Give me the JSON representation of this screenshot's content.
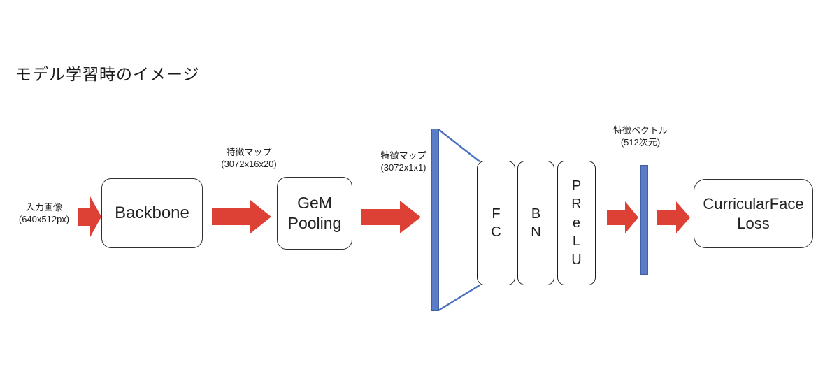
{
  "title": "モデル学習時のイメージ",
  "diagram": {
    "type": "pipeline-flow",
    "blocks": [
      {
        "id": "backbone",
        "label": "Backbone"
      },
      {
        "id": "gem_pooling",
        "label_line1": "GeM",
        "label_line2": "Pooling"
      },
      {
        "id": "fc",
        "letters": [
          "F",
          "C"
        ]
      },
      {
        "id": "bn",
        "letters": [
          "B",
          "N"
        ]
      },
      {
        "id": "prelu",
        "letters": [
          "P",
          "R",
          "e",
          "L",
          "U"
        ]
      },
      {
        "id": "curricularface_loss",
        "label_line1": "CurricularFace",
        "label_line2": "Loss"
      }
    ],
    "captions": {
      "input_image": {
        "line1": "入力画像",
        "line2": "(640x512px)"
      },
      "feature_map_1": {
        "line1": "特徴マップ",
        "line2": "(3072x16x20)"
      },
      "feature_map_2": {
        "line1": "特徴マップ",
        "line2": "(3072x1x1)"
      },
      "feature_vector": {
        "line1": "特徴ベクトル",
        "line2": "(512次元)"
      }
    },
    "colors": {
      "arrow_red": "#dd4136",
      "bar_blue": "#5b7cc6",
      "bar_blue_border": "#3f5fa8",
      "box_border": "#2f2f2f",
      "text": "#232323",
      "background": "#ffffff"
    },
    "arrow_count": 5,
    "blue_bar_count": 2
  }
}
